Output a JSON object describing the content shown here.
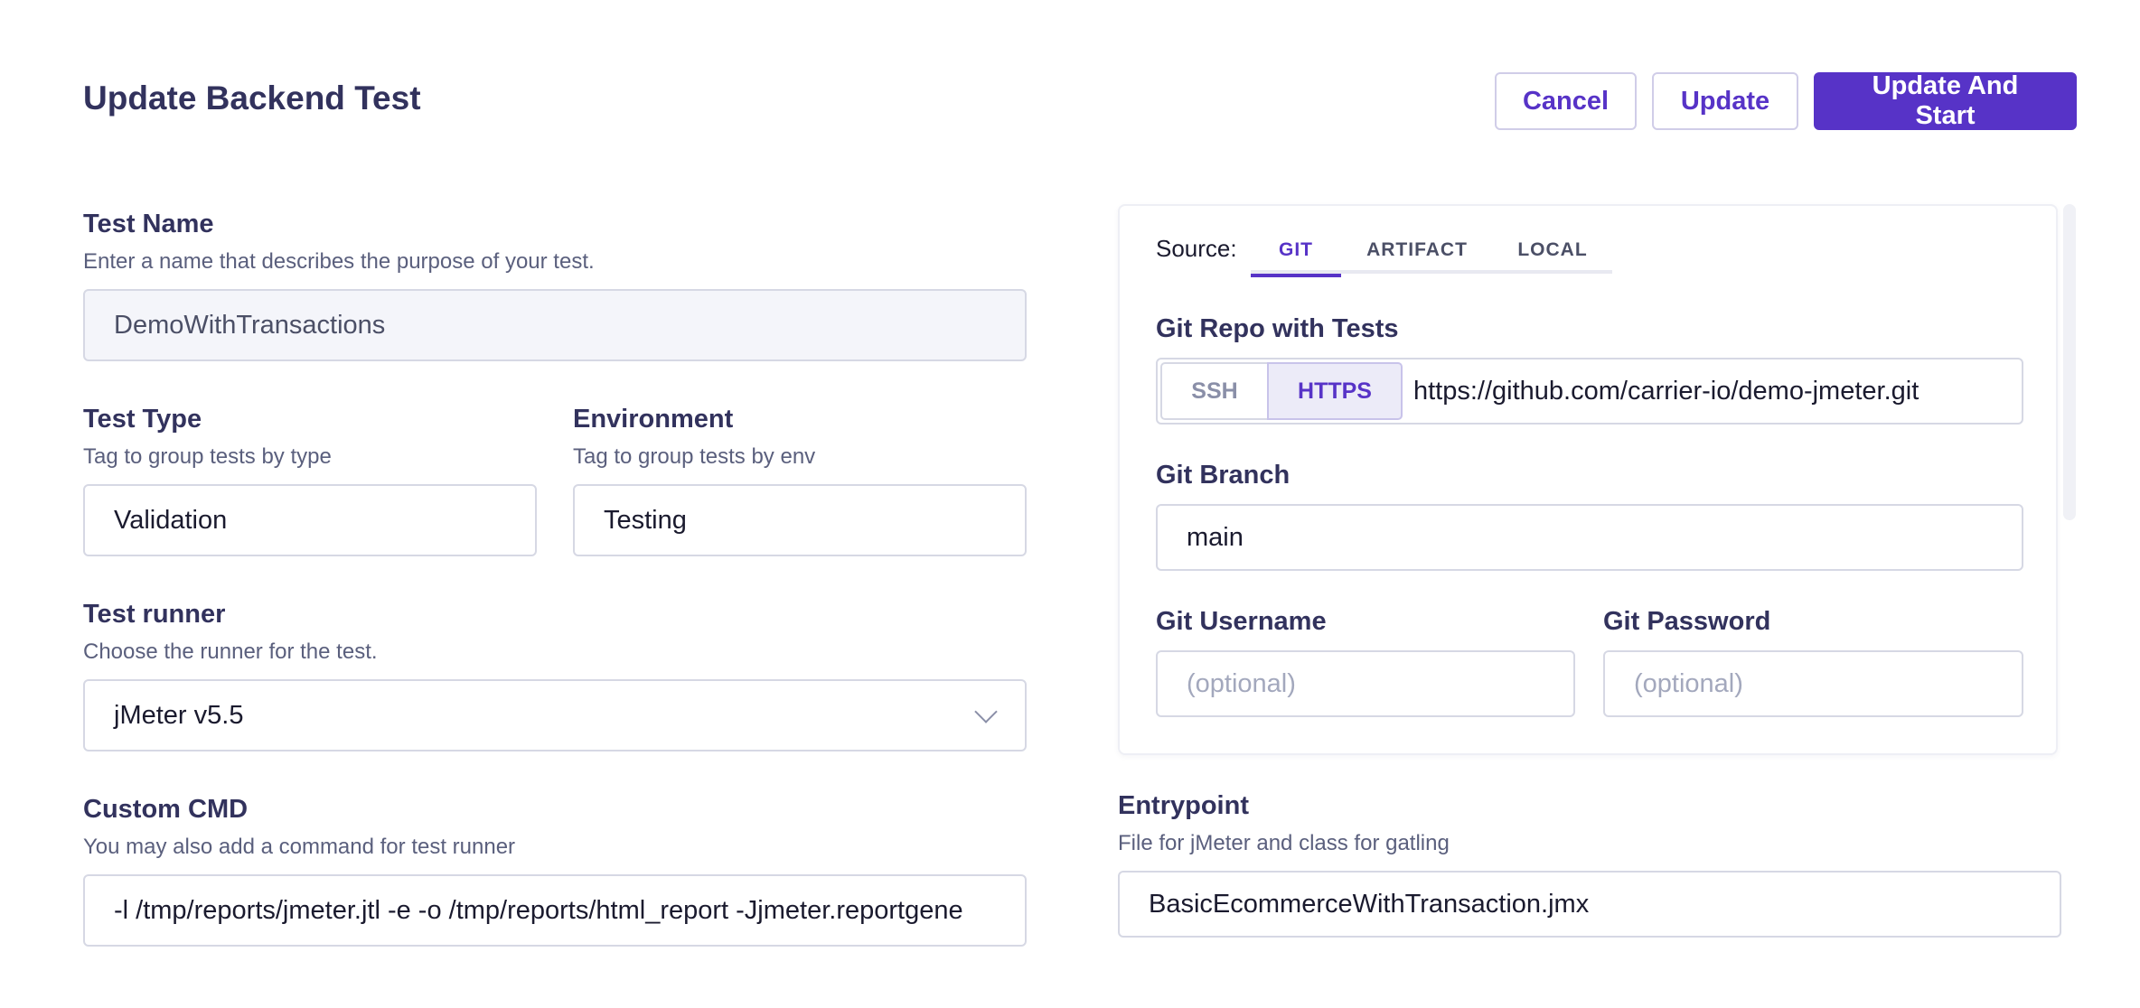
{
  "header": {
    "title": "Update Backend Test",
    "cancel_label": "Cancel",
    "update_label": "Update",
    "update_start_label": "Update And Start"
  },
  "form": {
    "test_name": {
      "label": "Test Name",
      "help": "Enter a name that describes the purpose of your test.",
      "value": "DemoWithTransactions"
    },
    "test_type": {
      "label": "Test Type",
      "help": "Tag to group tests by type",
      "value": "Validation"
    },
    "environment": {
      "label": "Environment",
      "help": "Tag to group tests by env",
      "value": "Testing"
    },
    "test_runner": {
      "label": "Test runner",
      "help": "Choose the runner for the test.",
      "value": "jMeter v5.5"
    },
    "custom_cmd": {
      "label": "Custom CMD",
      "help": "You may also add a command for test runner",
      "value": "-l /tmp/reports/jmeter.jtl -e -o /tmp/reports/html_report -Jjmeter.reportgene"
    }
  },
  "source": {
    "label": "Source:",
    "tabs": [
      {
        "label": "GIT",
        "active": true
      },
      {
        "label": "ARTIFACT",
        "active": false
      },
      {
        "label": "LOCAL",
        "active": false
      }
    ],
    "git_repo": {
      "label": "Git Repo with Tests",
      "protocols": [
        "SSH",
        "HTTPS"
      ],
      "selected_protocol": "HTTPS",
      "value": "https://github.com/carrier-io/demo-jmeter.git"
    },
    "git_branch": {
      "label": "Git Branch",
      "value": "main"
    },
    "git_username": {
      "label": "Git Username",
      "placeholder": "(optional)"
    },
    "git_password": {
      "label": "Git Password",
      "placeholder": "(optional)"
    }
  },
  "entrypoint": {
    "label": "Entrypoint",
    "help": "File for jMeter and class for gatling",
    "value": "BasicEcommerceWithTransaction.jmx"
  },
  "colors": {
    "accent": "#5733c7",
    "text_primary": "#32325d",
    "border": "#d6d8e4"
  }
}
